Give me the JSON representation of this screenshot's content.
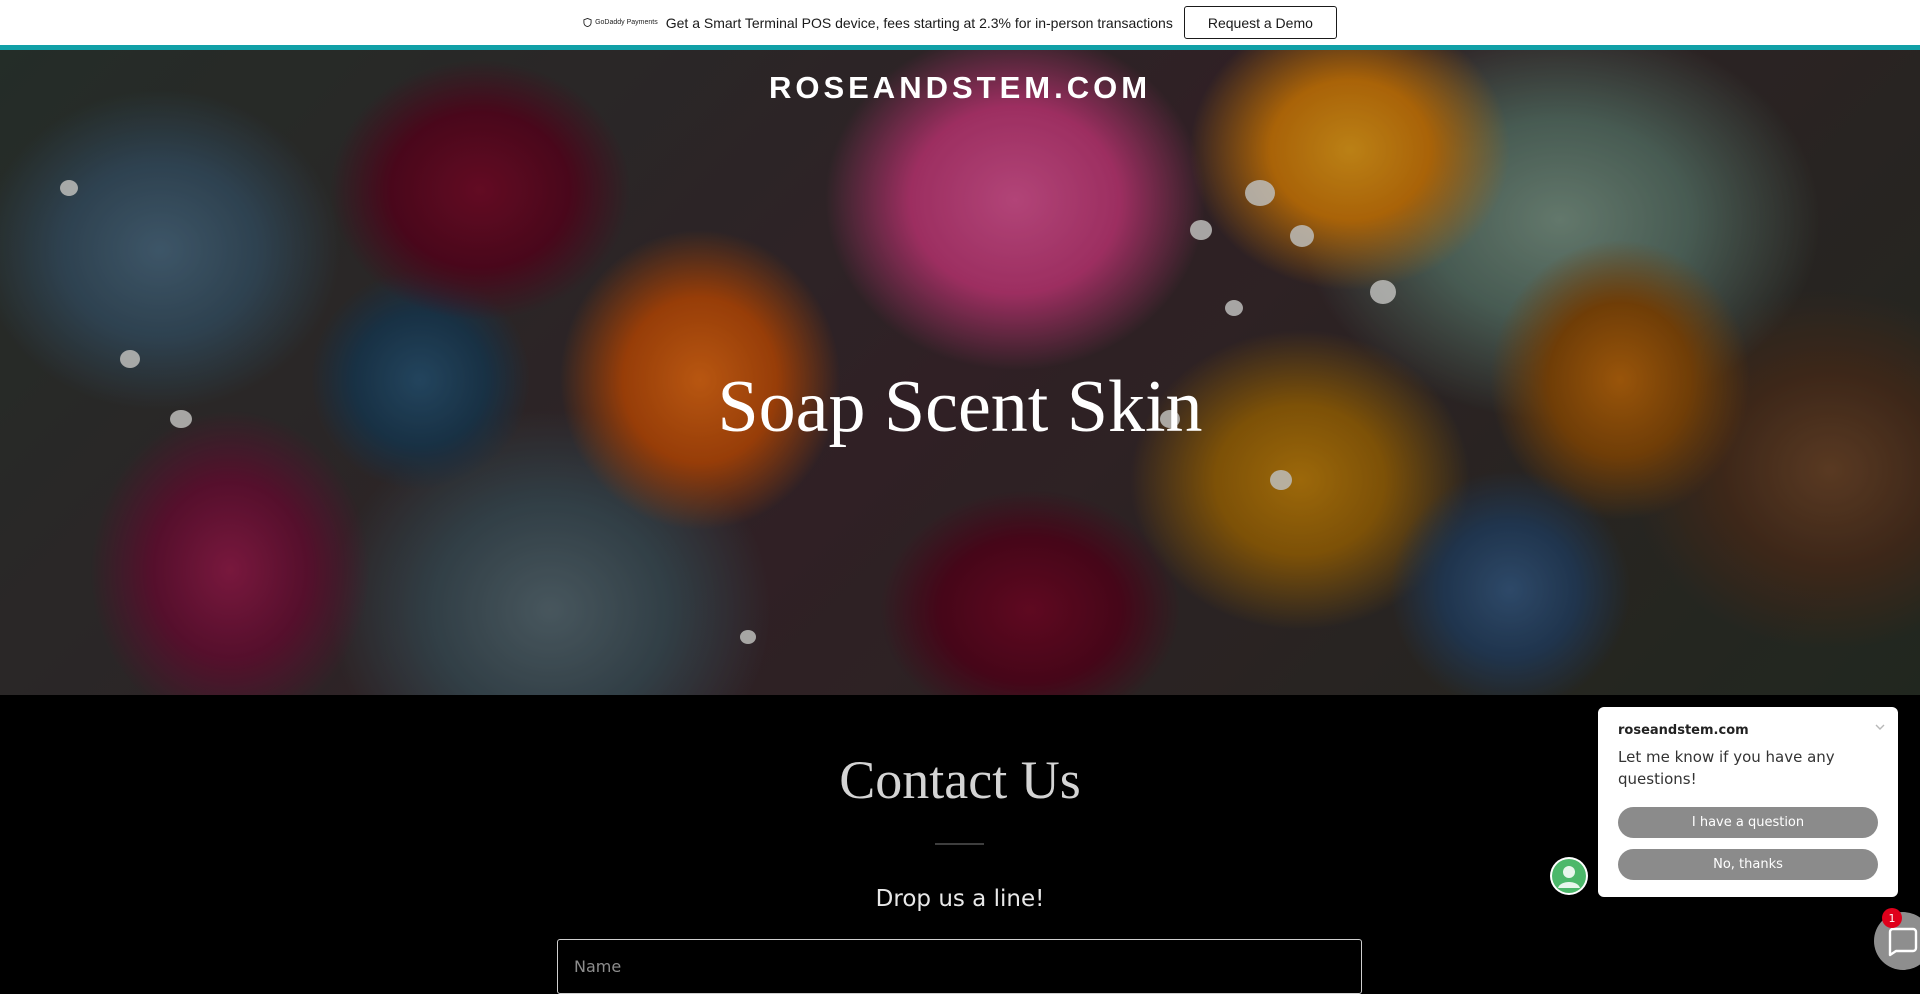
{
  "promo": {
    "logo_text": "GoDaddy Payments",
    "message": "Get a Smart Terminal POS device, fees starting at 2.3% for in-person transactions",
    "cta_label": "Request a Demo"
  },
  "hero": {
    "brand": "ROSEANDSTEM.COM",
    "title": "Soap Scent Skin"
  },
  "contact": {
    "title": "Contact Us",
    "subtitle": "Drop us a line!",
    "name_placeholder": "Name"
  },
  "chat": {
    "site_name": "roseandstem.com",
    "message": "Let me know if you have any questions!",
    "primary_option": "I have a question",
    "secondary_option": "No, thanks",
    "unread_count": "1"
  },
  "colors": {
    "accent": "#11a0a7",
    "chat_button": "#8b8b8b",
    "badge": "#e0001b"
  }
}
